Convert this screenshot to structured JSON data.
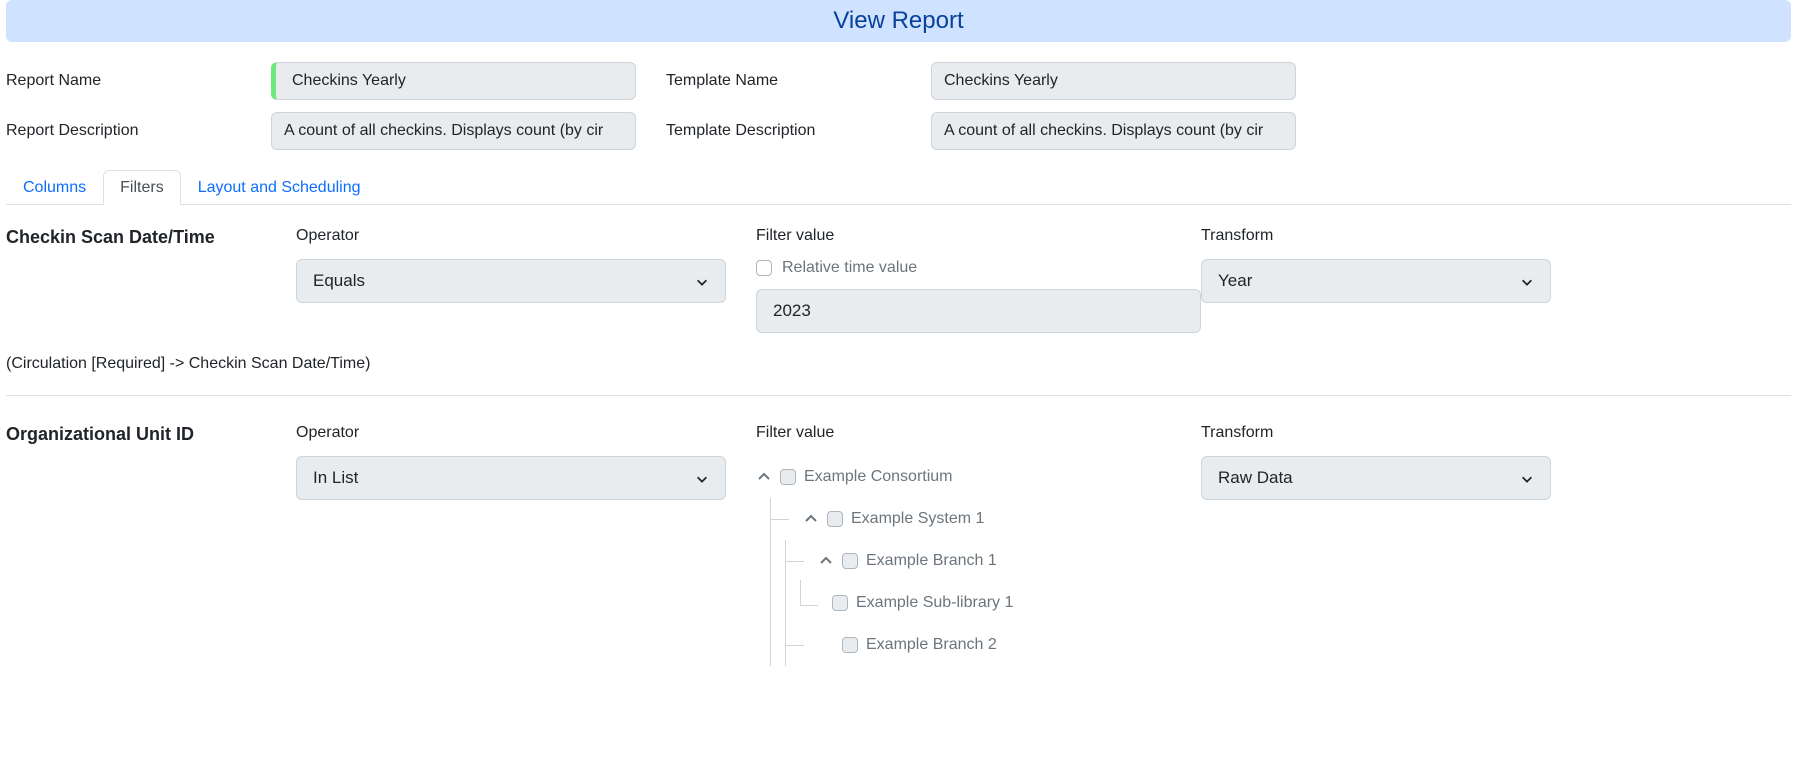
{
  "header": {
    "title": "View Report"
  },
  "info": {
    "reportNameLabel": "Report Name",
    "reportName": "Checkins Yearly",
    "reportDescriptionLabel": "Report Description",
    "reportDescription": "A count of all checkins. Displays count (by cir",
    "templateNameLabel": "Template Name",
    "templateName": "Checkins Yearly",
    "templateDescriptionLabel": "Template Description",
    "templateDescription": "A count of all checkins. Displays count (by cir"
  },
  "tabs": {
    "columns": "Columns",
    "filters": "Filters",
    "layout": "Layout and Scheduling"
  },
  "labels": {
    "operator": "Operator",
    "filterValue": "Filter value",
    "transform": "Transform",
    "relativeTime": "Relative time value"
  },
  "filter1": {
    "title": "Checkin Scan Date/Time",
    "operator": "Equals",
    "value": "2023",
    "transform": "Year",
    "path": "(Circulation [Required] -> Checkin Scan Date/Time)"
  },
  "filter2": {
    "title": "Organizational Unit ID",
    "operator": "In List",
    "transform": "Raw Data",
    "tree": {
      "n0": "Example Consortium",
      "n1": "Example System 1",
      "n2": "Example Branch 1",
      "n3": "Example Sub-library 1",
      "n4": "Example Branch 2"
    }
  }
}
